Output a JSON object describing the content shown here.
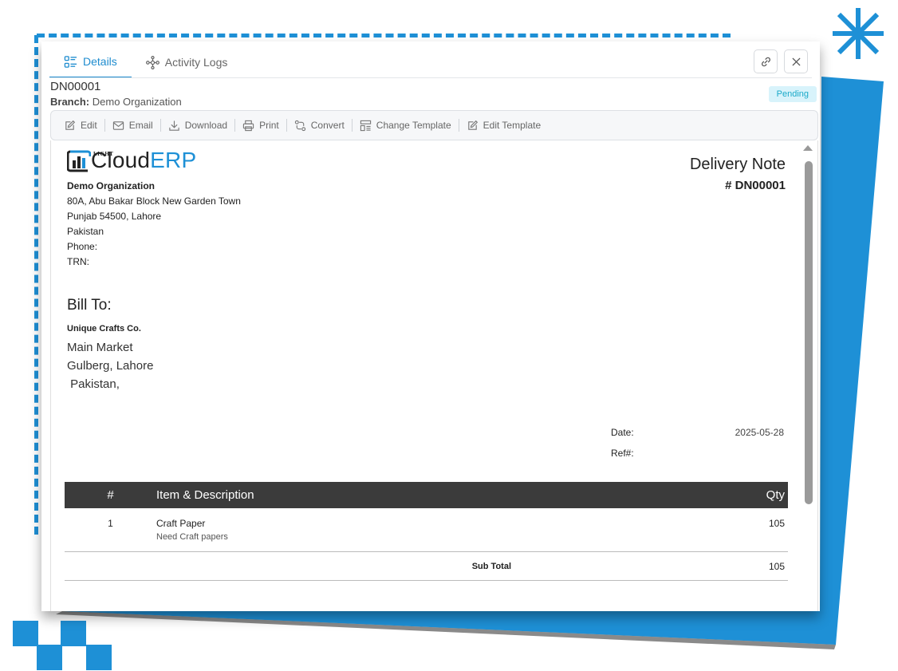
{
  "colors": {
    "accent": "#1e8ccf",
    "brand_blue": "#1e90d6",
    "badge_bg": "#d8f3fb",
    "badge_text": "#1aa9c9",
    "table_header": "#3b3b3b"
  },
  "tabs": [
    {
      "label": "Details",
      "icon": "details-list-icon",
      "active": true
    },
    {
      "label": "Activity Logs",
      "icon": "activity-nodes-icon",
      "active": false
    }
  ],
  "window_buttons": {
    "link_icon": "link-icon",
    "close_icon": "close-icon"
  },
  "header": {
    "doc_no": "DN00001",
    "branch_label": "Branch:",
    "branch_value": "Demo Organization",
    "status": "Pending"
  },
  "toolbar": [
    {
      "label": "Edit",
      "icon": "edit-icon"
    },
    {
      "label": "Email",
      "icon": "email-icon"
    },
    {
      "label": "Download",
      "icon": "download-icon"
    },
    {
      "label": "Print",
      "icon": "print-icon"
    },
    {
      "label": "Convert",
      "icon": "convert-icon"
    },
    {
      "label": "Change Template",
      "icon": "template-icon"
    },
    {
      "label": "Edit Template",
      "icon": "edit-icon"
    }
  ],
  "document": {
    "logo": {
      "light": "LIGHT",
      "cloud": "Cloud",
      "erp": "ERP"
    },
    "org": {
      "name": "Demo Organization",
      "address_line1": "80A, Abu Bakar Block New Garden Town",
      "address_line2": "Punjab 54500, Lahore",
      "country": "Pakistan",
      "phone": "Phone:",
      "trn": "TRN:"
    },
    "title": "Delivery Note",
    "number": "# DN00001",
    "bill_to_label": "Bill To:",
    "customer": {
      "name": "Unique Crafts Co.",
      "line1": "Main Market",
      "line2": "Gulberg, Lahore",
      "line3": " Pakistan,"
    },
    "date_label": "Date:",
    "date_value": "2025-05-28",
    "ref_label": "Ref#:",
    "ref_value": "",
    "table": {
      "headers": {
        "num": "#",
        "desc": "Item & Description",
        "qty": "Qty"
      },
      "rows": [
        {
          "num": "1",
          "name": "Craft Paper",
          "desc": "Need Craft papers",
          "qty": "105"
        }
      ],
      "subtotal_label": "Sub Total",
      "subtotal_value": "105"
    }
  }
}
